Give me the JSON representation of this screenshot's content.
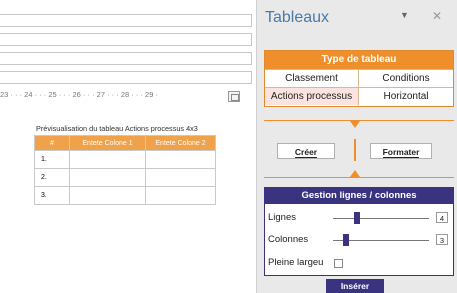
{
  "doc": {
    "ruler_text": "23 · · · 24 · · · 25 · · · 26 · · · 27 · · · 28 · · · 29 ·",
    "preview_caption": "Prévisualisation du tableau Actions processus 4x3",
    "table": {
      "headers": [
        "#",
        "Entete Colone 1",
        "Entete Colone 2"
      ],
      "rows": [
        [
          "1.",
          "",
          ""
        ],
        [
          "2.",
          "",
          ""
        ],
        [
          "3.",
          "",
          ""
        ]
      ]
    }
  },
  "panel": {
    "title": "Tableaux",
    "dropdown_icon": "chevron-down-icon",
    "close_icon": "close-icon",
    "type_section": {
      "header": "Type de tableau",
      "options": [
        "Classement",
        "Conditions",
        "Actions processus",
        "Horizontal"
      ],
      "selected": "Actions processus"
    },
    "buttons": {
      "create": "Créer",
      "format": "Formater"
    },
    "gestion": {
      "header": "Gestion lignes / colonnes",
      "rows_label": "Lignes",
      "rows_value": "4",
      "cols_label": "Colonnes",
      "cols_value": "3",
      "full_width_label": "Pleine largeu"
    },
    "insert_label": "Insérer"
  },
  "colors": {
    "accent_orange": "#ee8f2c",
    "accent_navy": "#3a3380",
    "title_blue": "#4a79a8"
  }
}
